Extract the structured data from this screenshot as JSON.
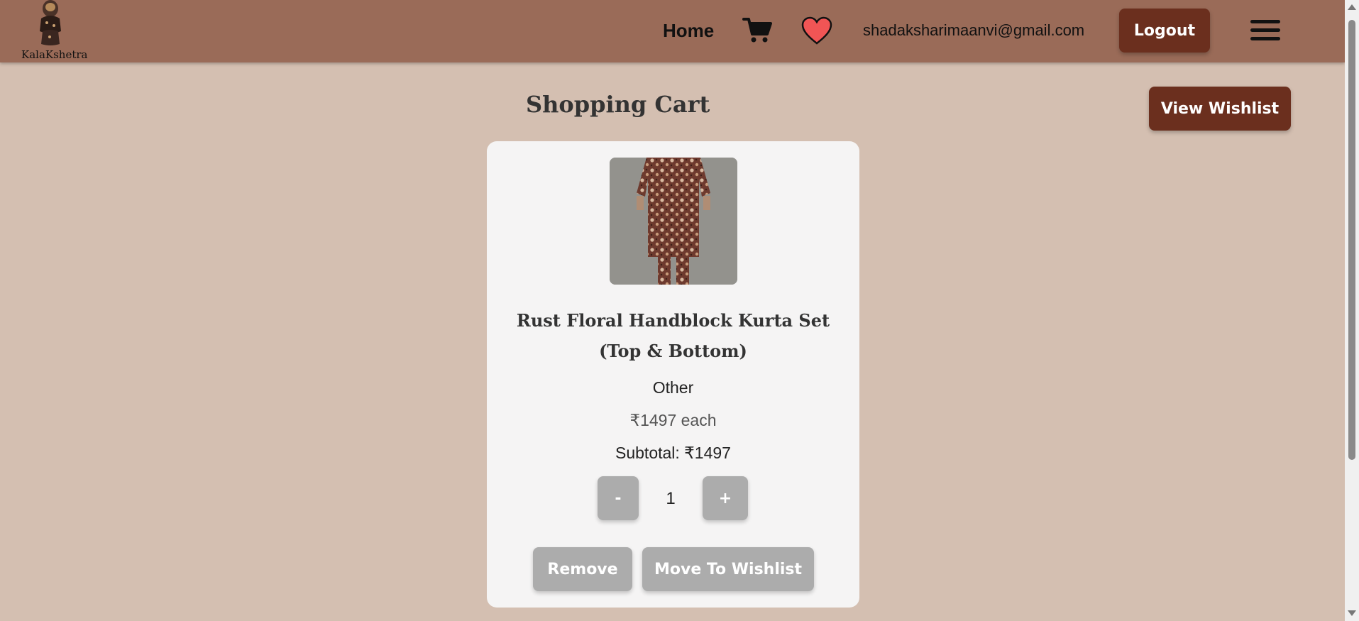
{
  "brand": {
    "name": "KalaKshetra"
  },
  "nav": {
    "home_label": "Home",
    "cart_icon": "cart-icon",
    "wishlist_icon": "heart-icon",
    "user_email": "shadaksharimaanvi@gmail.com",
    "logout_label": "Logout",
    "menu_icon": "hamburger-menu-icon"
  },
  "page": {
    "title": "Shopping Cart",
    "view_wishlist_label": "View Wishlist"
  },
  "cart": {
    "items": [
      {
        "name": "Rust Floral Handblock Kurta Set (Top & Bottom)",
        "category": "Other",
        "price": "₹1497 each",
        "subtotal": "Subtotal: ₹1497",
        "quantity": "1",
        "decrement_label": "-",
        "increment_label": "+",
        "remove_label": "Remove",
        "move_to_wishlist_label": "Move To Wishlist"
      }
    ]
  },
  "colors": {
    "navbar": "#9a6b58",
    "background": "#d4bfb1",
    "primary_button": "#6b2f1e",
    "disabled_button": "#acacac",
    "heart": "#f05555"
  }
}
